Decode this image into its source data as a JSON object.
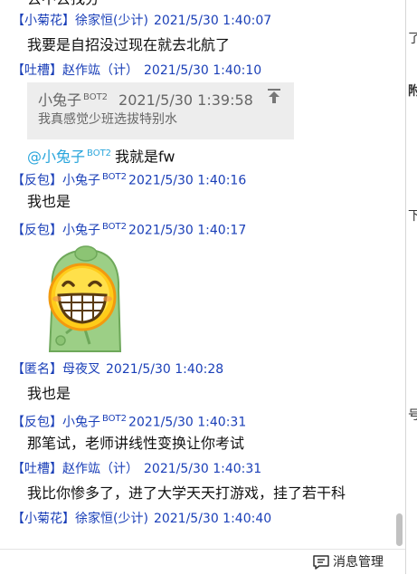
{
  "top_partial_text": "去不去找分",
  "messages": [
    {
      "tag": "【小菊花】",
      "name": "徐家恒(少计)",
      "time": "2021/5/30 1:40:07",
      "text": "我要是自招没过现在就去北航了"
    },
    {
      "tag": "【吐槽】",
      "name": "赵作竑（计）",
      "time": "2021/5/30 1:40:10",
      "quote": {
        "name": "小兔子",
        "bot": "BOT2",
        "time": "2021/5/30 1:39:58",
        "text": "我真感觉少班选拔特别水"
      },
      "reply": {
        "at": "@小兔子",
        "bot": "BOT2",
        "text": "我就是fw"
      }
    },
    {
      "tag": "【反包】",
      "name": "小兔子",
      "bot": "BOT2",
      "time": "2021/5/30 1:40:16",
      "text": "我也是"
    },
    {
      "tag": "【反包】",
      "name": "小兔子",
      "bot": "BOT2",
      "time": "2021/5/30 1:40:17",
      "sticker": "grinning-bean-sticker"
    },
    {
      "tag": "【匿名】",
      "name": "母夜叉",
      "time": "2021/5/30 1:40:28",
      "text": "我也是"
    },
    {
      "tag": "【反包】",
      "name": "小兔子",
      "bot": "BOT2",
      "time": "2021/5/30 1:40:31",
      "text": "那笔试，老师讲线性变换让你考试"
    },
    {
      "tag": "【吐槽】",
      "name": "赵作竑（计）",
      "time": "2021/5/30 1:40:31",
      "text": "我比你惨多了，进了大学天天打游戏，挂了若干科"
    },
    {
      "tag": "【小菊花】",
      "name": "徐家恒(少计)",
      "time": "2021/5/30 1:40:40"
    }
  ],
  "footer": {
    "manage_label": "消息管理",
    "manage_icon": "message-manage-icon"
  },
  "side_partial": [
    "了",
    "附",
    "下",
    "号"
  ],
  "colors": {
    "header": "#1a3fb8",
    "mention": "#2aa6dc",
    "quote_bg": "#ededed"
  }
}
